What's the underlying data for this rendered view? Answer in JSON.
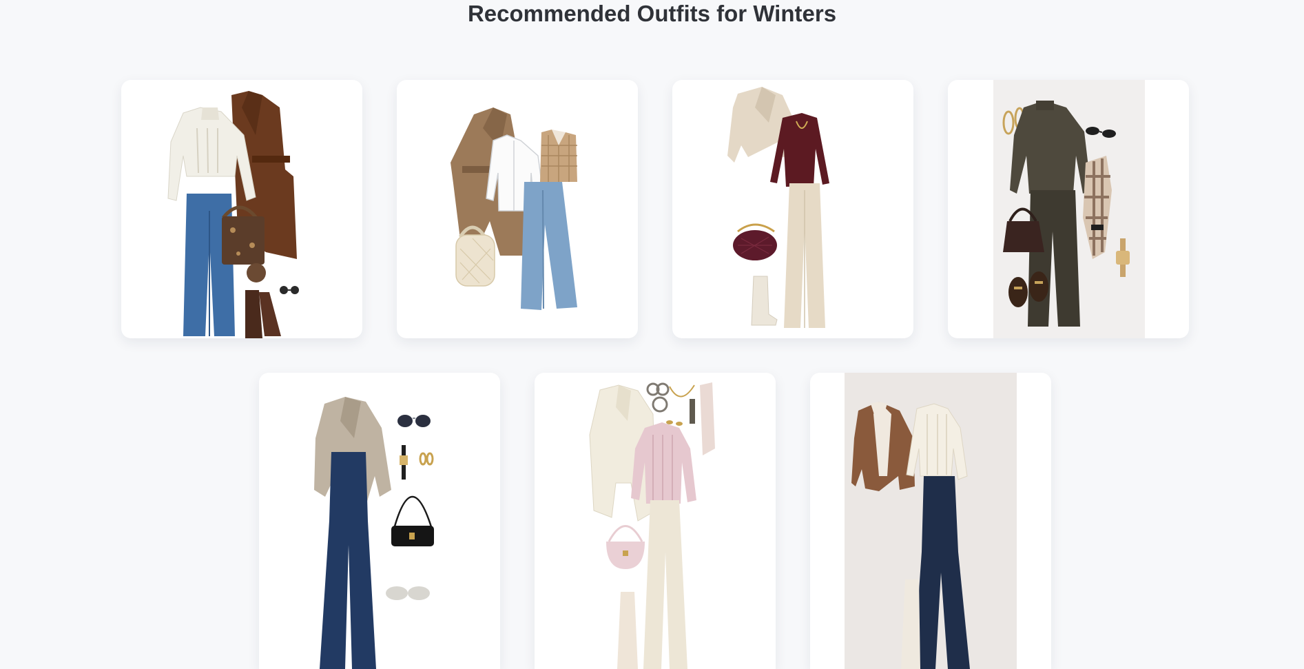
{
  "page": {
    "title": "Recommended Outfits for Winters"
  },
  "outfits": [
    {
      "id": 1,
      "items": [
        "cream-cable-knit-sweater-icon",
        "brown-wrap-coat-icon",
        "blue-wide-leg-jeans-icon",
        "monogram-tote-bag-icon",
        "brown-ankle-boots-icon",
        "sunglasses-icon"
      ]
    },
    {
      "id": 2,
      "items": [
        "camel-trench-coat-icon",
        "white-shirt-icon",
        "checked-sweater-vest-icon",
        "light-wash-jeans-icon",
        "quilted-backpack-icon"
      ]
    },
    {
      "id": 3,
      "items": [
        "beige-cropped-coat-icon",
        "burgundy-knit-top-icon",
        "cream-trousers-icon",
        "burgundy-woven-bag-icon",
        "cream-ankle-boots-icon"
      ]
    },
    {
      "id": 4,
      "items": [
        "olive-turtleneck-sweater-icon",
        "olive-trousers-icon",
        "plaid-scarf-icon",
        "brown-handbag-icon",
        "loafers-icon",
        "sunglasses-icon",
        "gold-watch-icon",
        "hoop-earrings-icon"
      ]
    },
    {
      "id": 5,
      "items": [
        "taupe-wool-coat-icon",
        "dark-flared-jeans-icon",
        "sunglasses-icon",
        "watch-icon",
        "earrings-icon",
        "black-shoulder-bag-icon"
      ]
    },
    {
      "id": 6,
      "items": [
        "cream-long-coat-icon",
        "pink-knit-sweater-icon",
        "cream-wide-trousers-icon",
        "pink-handbag-icon",
        "jewelry-icon",
        "scarf-icon"
      ]
    },
    {
      "id": 7,
      "items": [
        "shearling-jacket-icon",
        "cream-cable-knit-sweater-icon",
        "navy-flared-jeans-icon"
      ]
    }
  ],
  "colors": {
    "background": "#f7f8fa",
    "card": "#ffffff",
    "title": "#2f3238"
  }
}
